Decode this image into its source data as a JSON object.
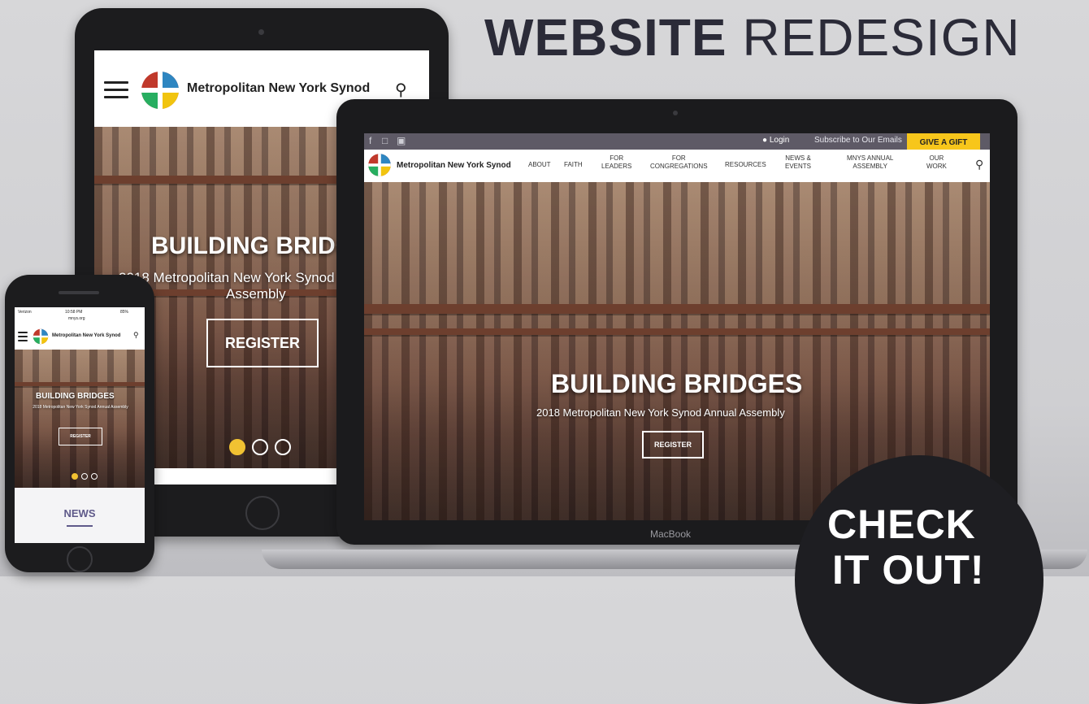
{
  "headline": {
    "bold": "WEBSITE",
    "light": "REDESIGN"
  },
  "tablet": {
    "site_title": "Metropolitan New York Synod",
    "hero_title": "BUILDING BRIDGES",
    "hero_sub_line1": "2018 Metropolitan New York Synod",
    "hero_sub_line2": "Assembly",
    "register": "REGISTER"
  },
  "laptop": {
    "brand": "MacBook",
    "top_links": {
      "login": "Login",
      "subscribe": "Subscribe to Our Emails",
      "gift": "GIVE A GIFT"
    },
    "site_title": "Metropolitan New York Synod",
    "nav": [
      "ABOUT",
      "FAITH",
      "FOR\nLEADERS",
      "FOR\nCONGREGATIONS",
      "RESOURCES",
      "NEWS &\nEVENTS",
      "MNYS ANNUAL\nASSEMBLY",
      "OUR\nWORK"
    ],
    "hero_title": "BUILDING BRIDGES",
    "hero_sub": "2018 Metropolitan New York Synod Annual Assembly",
    "register": "REGISTER"
  },
  "phone": {
    "carrier": "Verizon",
    "time": "10:58 PM",
    "battery": "85%",
    "url": "mnys.org",
    "site_title": "Metropolitan New York Synod",
    "hero_title": "BUILDING BRIDGES",
    "hero_sub": "2018 Metropolitan New York Synod Annual Assembly",
    "register": "REGISTER",
    "news": "NEWS"
  },
  "badge": {
    "line1": "CHECK",
    "line2": "IT OUT!"
  },
  "colors": {
    "gift": "#f7c61b",
    "dot_active": "#f1c232",
    "news": "#5f5a8a",
    "topbar": "#5e5a66"
  }
}
